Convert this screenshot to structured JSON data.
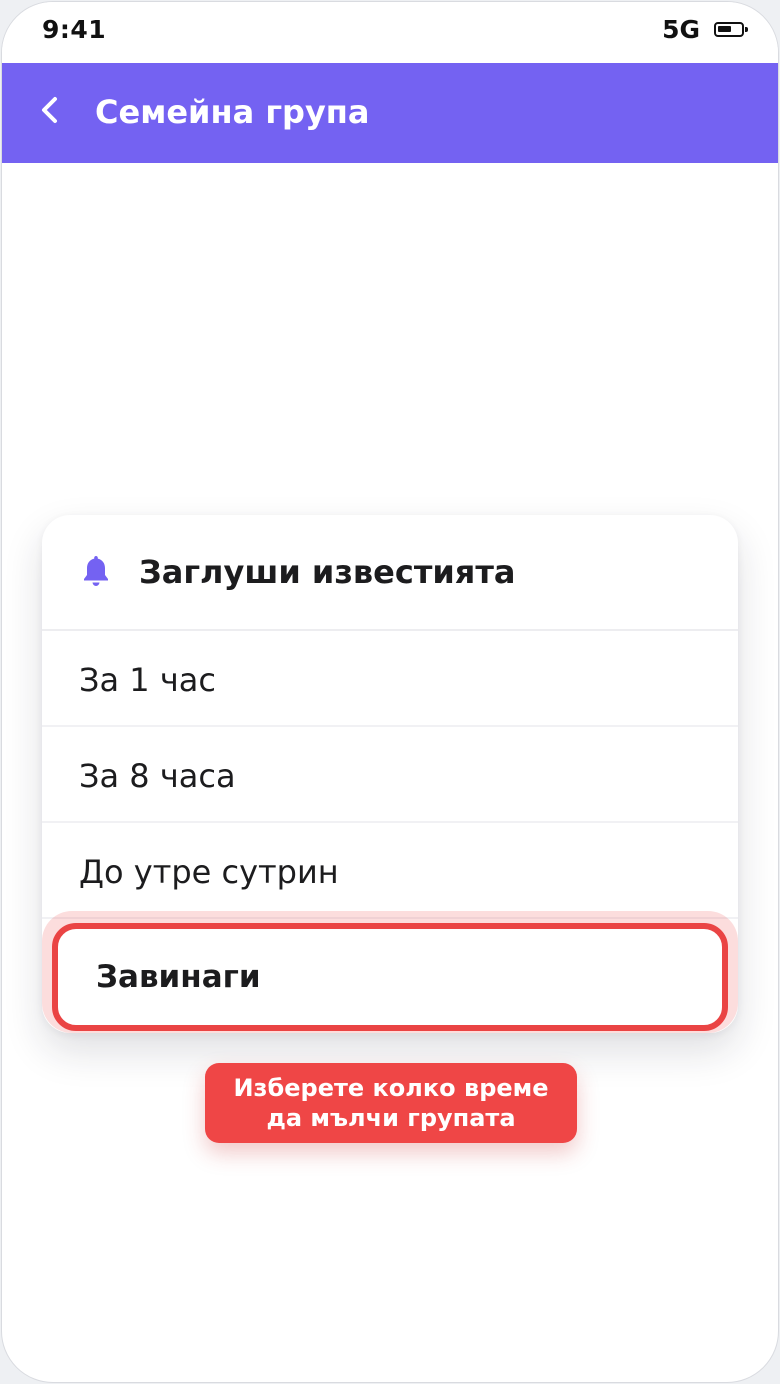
{
  "status_bar": {
    "time": "9:41",
    "network": "5G",
    "battery_level": 0.6
  },
  "header": {
    "back_icon": "chevron-left-icon",
    "title": "Семейна група",
    "color": "#7462f2"
  },
  "mute_sheet": {
    "icon": "bell-icon",
    "icon_color": "#7462f2",
    "title": "Заглуши известията",
    "options": [
      {
        "label": "За 1 час"
      },
      {
        "label": "За 8 часа"
      },
      {
        "label": "До утре сутрин"
      },
      {
        "label": "Завинаги",
        "highlighted": true
      }
    ],
    "highlight_color": "#ea4444"
  },
  "tooltip": {
    "line1": "Изберете колко време",
    "line2": "да мълчи групата",
    "color": "#ef4646"
  }
}
